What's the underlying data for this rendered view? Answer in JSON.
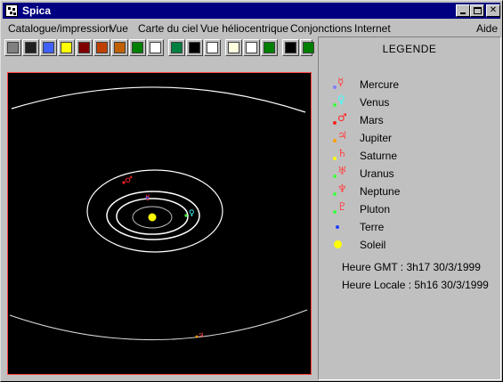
{
  "window": {
    "title": "Spica"
  },
  "menu": [
    {
      "label": "Catalogue/impression"
    },
    {
      "label": "Vue"
    },
    {
      "label": "Carte du ciel"
    },
    {
      "label": "Vue héliocentrique"
    },
    {
      "label": "Conjonctions"
    },
    {
      "label": "Internet"
    },
    {
      "label": "Aide"
    }
  ],
  "toolbar": [
    {
      "icon": "print-icon",
      "color": "#808080"
    },
    {
      "icon": "sky-chart-icon",
      "color": "#202020"
    },
    {
      "icon": "gradient-icon",
      "color": "#4060ff"
    },
    {
      "icon": "sun-rays-icon",
      "color": "#ffff00"
    },
    {
      "icon": "bars-icon",
      "color": "#800000"
    },
    {
      "icon": "target-icon",
      "color": "#c04000"
    },
    {
      "icon": "saturn-icon",
      "color": "#c06000"
    },
    {
      "icon": "graph-icon",
      "color": "#008000"
    },
    {
      "icon": "table-icon",
      "color": "#ffffff"
    },
    {
      "icon": "globe-icon",
      "color": "#008040"
    },
    {
      "icon": "star-map-icon",
      "color": "#000000"
    },
    {
      "icon": "mail-icon",
      "color": "#ffffff"
    },
    {
      "icon": "clipboard-icon",
      "color": "#ffffe0"
    },
    {
      "icon": "page-icon",
      "color": "#ffffff"
    },
    {
      "icon": "tree-icon",
      "color": "#008000"
    },
    {
      "icon": "first-icon",
      "color": "#000000"
    },
    {
      "icon": "previous-icon",
      "color": "#008000"
    }
  ],
  "legend": {
    "title": "LEGENDE",
    "items": [
      {
        "name": "Mercure",
        "glyph": "☿",
        "color": "#ff4040",
        "dot": "#8080ff"
      },
      {
        "name": "Venus",
        "glyph": "♀",
        "color": "#40ffff",
        "dot": "#40ff40"
      },
      {
        "name": "Mars",
        "glyph": "♂",
        "color": "#ff2020",
        "dot": "#ff2020"
      },
      {
        "name": "Jupiter",
        "glyph": "♃",
        "color": "#ff4040",
        "dot": "#ffa000"
      },
      {
        "name": "Saturne",
        "glyph": "♄",
        "color": "#ff4040",
        "dot": "#ffff00"
      },
      {
        "name": "Uranus",
        "glyph": "♅",
        "color": "#ff4040",
        "dot": "#40ff40"
      },
      {
        "name": "Neptune",
        "glyph": "♆",
        "color": "#ff4040",
        "dot": "#40ff40"
      },
      {
        "name": "Pluton",
        "glyph": "♇",
        "color": "#ff4040",
        "dot": "#40ff40"
      },
      {
        "name": "Terre",
        "glyph": "",
        "color": "#2040ff",
        "dot": "#2040ff"
      },
      {
        "name": "Soleil",
        "glyph": "",
        "color": "#ffff00",
        "dot": "#ffff00"
      }
    ],
    "time_gmt": "Heure GMT : 3h17 30/3/1999",
    "time_local": "Heure Locale : 5h16 30/3/1999"
  }
}
